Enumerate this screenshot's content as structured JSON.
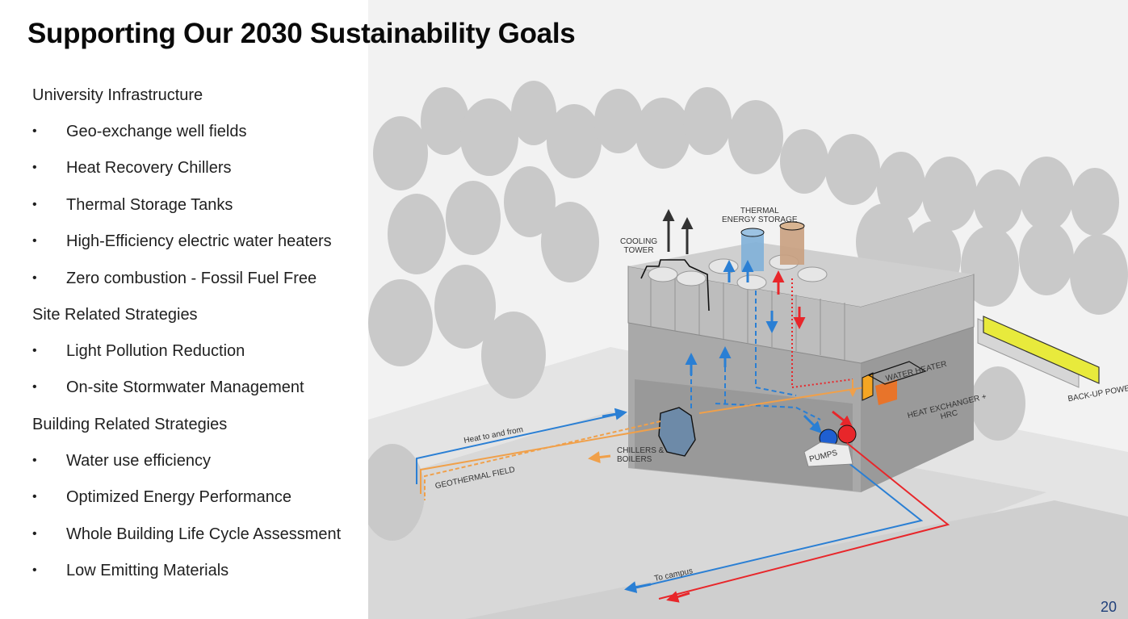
{
  "title": "Supporting Our 2030 Sustainability Goals",
  "sections": [
    {
      "heading": "University Infrastructure",
      "items": [
        "Geo-exchange well fields",
        "Heat Recovery Chillers",
        "Thermal Storage Tanks",
        "High-Efficiency electric water heaters",
        "Zero combustion - Fossil Fuel Free"
      ]
    },
    {
      "heading": "Site Related Strategies",
      "items": [
        "Light Pollution Reduction",
        "On-site Stormwater Management"
      ]
    },
    {
      "heading": "Building Related Strategies",
      "items": [
        "Water use efficiency",
        "Optimized Energy Performance",
        "Whole Building Life Cycle Assessment",
        "Low Emitting Materials"
      ]
    }
  ],
  "bullet": "•",
  "diagram": {
    "labels": {
      "cooling_tower": "COOLING\nTOWER",
      "thermal_storage": "THERMAL\nENERGY STORAGE",
      "water_heater": "WATER HEATER",
      "heat_exchanger": "HEAT EXCHANGER +\nHRC",
      "backup_power": "BACK-UP POWER",
      "heat_to_from": "Heat to and from",
      "chillers_boilers": "CHILLERS &\nBOILERS",
      "pumps": "PUMPS",
      "geothermal_field": "GEOTHERMAL FIELD",
      "to_campus": "To campus"
    },
    "colors": {
      "cold_water": "#2a7fd4",
      "hot_water": "#e8262a",
      "geothermal": "#f0a04a",
      "backup": "#e8ea3c",
      "heater": "#f5a623",
      "tank_cold": "#7fb0d8",
      "tank_hot": "#c9a080"
    }
  },
  "page_number": "20"
}
